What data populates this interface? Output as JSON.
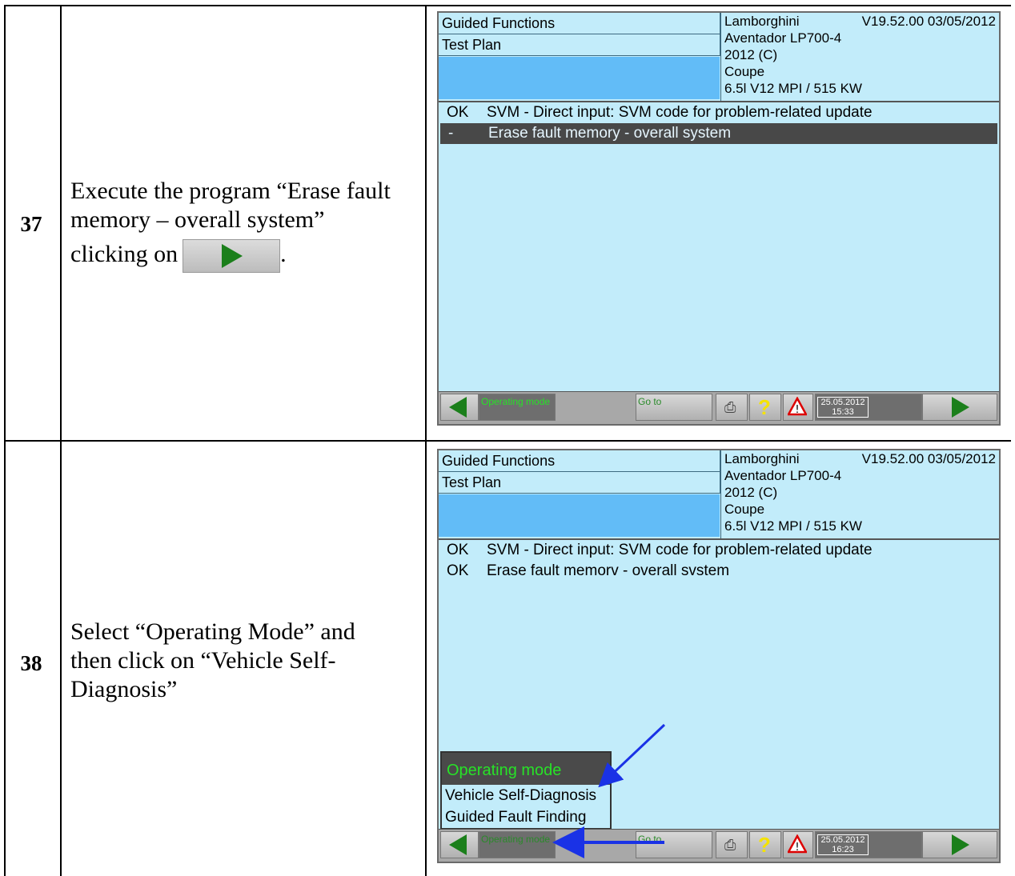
{
  "rows": [
    {
      "number": "37",
      "instruction_lines": [
        "Execute the program “Erase fault",
        "memory – overall system”",
        "clicking on"
      ],
      "instruction_end": "."
    },
    {
      "number": "38",
      "instruction_lines": [
        "Select “Operating Mode” and",
        "then click on “Vehicle Self-",
        "Diagnosis”"
      ]
    }
  ],
  "screens": [
    {
      "header_left": [
        "Guided Functions",
        "Test Plan"
      ],
      "info": {
        "make": "Lamborghini",
        "version": "V19.52.00 03/05/2012",
        "model": "Aventador LP700-4",
        "year": "2012 (C)",
        "body": "Coupe",
        "engine": "6.5l V12 MPI / 515 KW"
      },
      "plan": [
        {
          "status": "OK",
          "text": "SVM - Direct input: SVM code for problem-related update",
          "selected": false
        },
        {
          "status": "-",
          "text": "Erase fault memory - overall system",
          "selected": true
        }
      ],
      "toolbar": {
        "operating_mode": "Operating mode",
        "goto": "Go to",
        "help": "?",
        "date": "25.05.2012",
        "time": "15:33"
      }
    },
    {
      "header_left": [
        "Guided Functions",
        "Test Plan"
      ],
      "info": {
        "make": "Lamborghini",
        "version": "V19.52.00 03/05/2012",
        "model": "Aventador LP700-4",
        "year": "2012 (C)",
        "body": "Coupe",
        "engine": "6.5l V12 MPI / 515 KW"
      },
      "plan": [
        {
          "status": "OK",
          "text": "SVM - Direct input: SVM code for problem-related update",
          "selected": false
        },
        {
          "status": "OK",
          "text": "Erase fault memorv - overall svstem",
          "selected": false
        }
      ],
      "menu": {
        "title": "Operating mode",
        "items": [
          "Vehicle Self-Diagnosis",
          "Guided Fault Finding"
        ]
      },
      "toolbar": {
        "operating_mode": "Operating mode",
        "goto": "Go to",
        "help": "?",
        "date": "25.05.2012",
        "time": "16:23"
      }
    }
  ],
  "colors": {
    "screen_bg": "#c2ecfa",
    "arrow": "#1a32e6",
    "green": "#1b7f1b"
  }
}
